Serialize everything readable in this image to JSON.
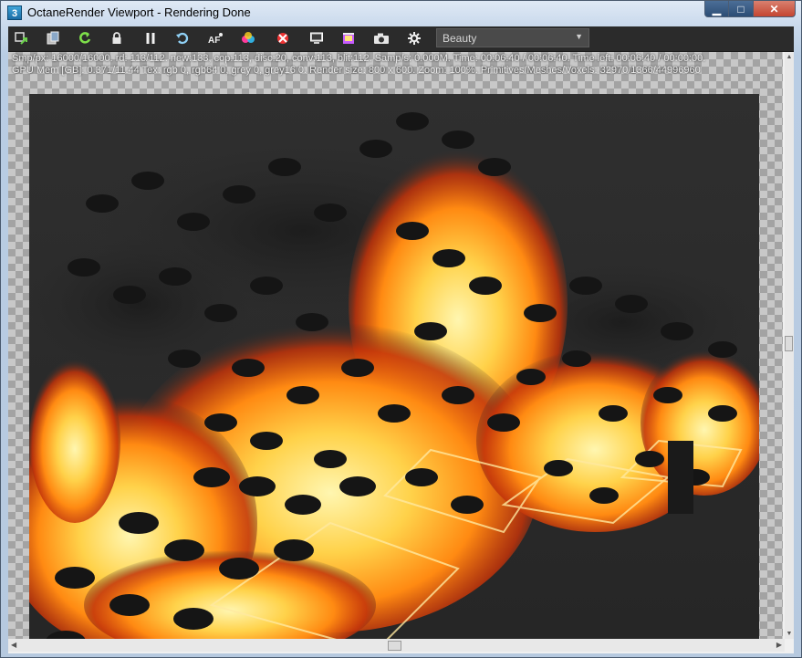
{
  "window": {
    "app_icon_label": "3",
    "title": "OctaneRender Viewport - Rendering Done",
    "minimize_glyph": "▁",
    "maximize_glyph": "□",
    "close_glyph": "✕"
  },
  "toolbar": {
    "buttons": [
      {
        "name": "send-to-viewport-icon"
      },
      {
        "name": "copy-to-clipboard-icon"
      },
      {
        "name": "restart-render-icon"
      },
      {
        "name": "lock-icon"
      },
      {
        "name": "pause-icon"
      },
      {
        "name": "refresh-icon"
      },
      {
        "name": "auto-focus-icon"
      },
      {
        "name": "color-picker-icon"
      },
      {
        "name": "region-render-icon"
      },
      {
        "name": "display-settings-icon"
      },
      {
        "name": "film-settings-icon"
      },
      {
        "name": "camera-icon"
      },
      {
        "name": "settings-gear-icon"
      }
    ],
    "render_pass": {
      "selected": "Beauty",
      "arrow": "▼"
    }
  },
  "stats": {
    "line1": "Smp/px: 16000/16000.    rd: 113/112.    new:133, cop:113, disc:20, conv:113, blit:112.    Samp/s: 0.000M.    Time: 00:06:40 / 00:06:40.    Time left: 00:06:40 / 00:00:00.",
    "line2": "GPU Mem [GB]: 0.371/11.44    Tex: rgb 0, rgb64 0, grey 0, grey16 0.    Render size: 800 x 600.    Zoom: 100%.    Primitives/Meshes/Voxels: 32970/1366/44996960"
  },
  "colors": {
    "toolbar_bg": "#2b2b2b",
    "render_bg": "#2e2e2e",
    "fire_core": "#fff6b0",
    "fire_mid": "#ff9a1a",
    "fire_edge": "#c2330a"
  }
}
